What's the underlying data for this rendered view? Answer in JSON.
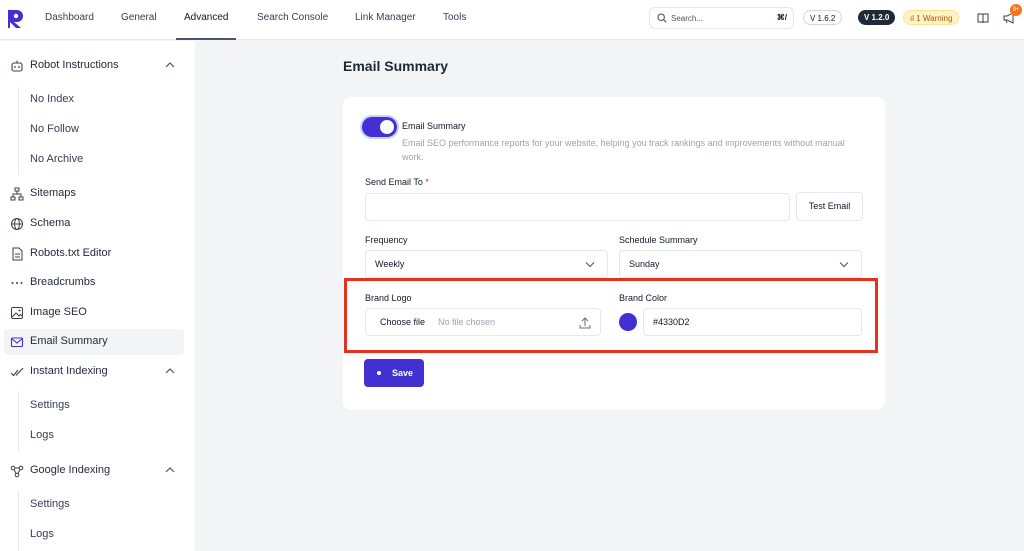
{
  "topbar": {
    "tabs": [
      {
        "label": "Dashboard"
      },
      {
        "label": "General"
      },
      {
        "label": "Advanced"
      },
      {
        "label": "Search Console"
      },
      {
        "label": "Link Manager"
      },
      {
        "label": "Tools"
      }
    ],
    "active_tab": "Advanced",
    "search": {
      "placeholder": "Search...",
      "shortcut": "⌘/"
    },
    "version_light": "V 1.6.2",
    "version_dark": "V 1.2.0",
    "warning": "1 Warning",
    "notification_count": "9+",
    "brand_color": "#4330d2"
  },
  "sidebar": {
    "robot_instructions": {
      "label": "Robot Instructions",
      "children": [
        "No Index",
        "No Follow",
        "No Archive"
      ]
    },
    "items": [
      {
        "label": "Sitemaps",
        "icon": "sitemap-icon"
      },
      {
        "label": "Schema",
        "icon": "globe-icon"
      },
      {
        "label": "Robots.txt Editor",
        "icon": "document-icon"
      },
      {
        "label": "Breadcrumbs",
        "icon": "dots-icon"
      },
      {
        "label": "Image SEO",
        "icon": "image-icon"
      },
      {
        "label": "Email Summary",
        "icon": "mail-icon",
        "active": true
      }
    ],
    "instant_indexing": {
      "label": "Instant Indexing",
      "children": [
        "Settings",
        "Logs"
      ]
    },
    "google_indexing": {
      "label": "Google Indexing",
      "children": [
        "Settings",
        "Logs"
      ]
    }
  },
  "main": {
    "title": "Email Summary",
    "toggle": {
      "label": "Email Summary",
      "on": true,
      "description": "Email SEO performance reports for your website, helping you track rankings and improvements without manual work."
    },
    "send_to": {
      "label": "Send Email To",
      "required": "*",
      "value": "",
      "button": "Test Email"
    },
    "frequency": {
      "label": "Frequency",
      "value": "Weekly"
    },
    "schedule": {
      "label": "Schedule Summary",
      "value": "Sunday"
    },
    "brand_logo": {
      "label": "Brand Logo",
      "button": "Choose file",
      "status": "No file chosen"
    },
    "brand_color": {
      "label": "Brand Color",
      "value": "#4330D2"
    },
    "save_label": "Save",
    "highlight_color": "#e8301e"
  }
}
